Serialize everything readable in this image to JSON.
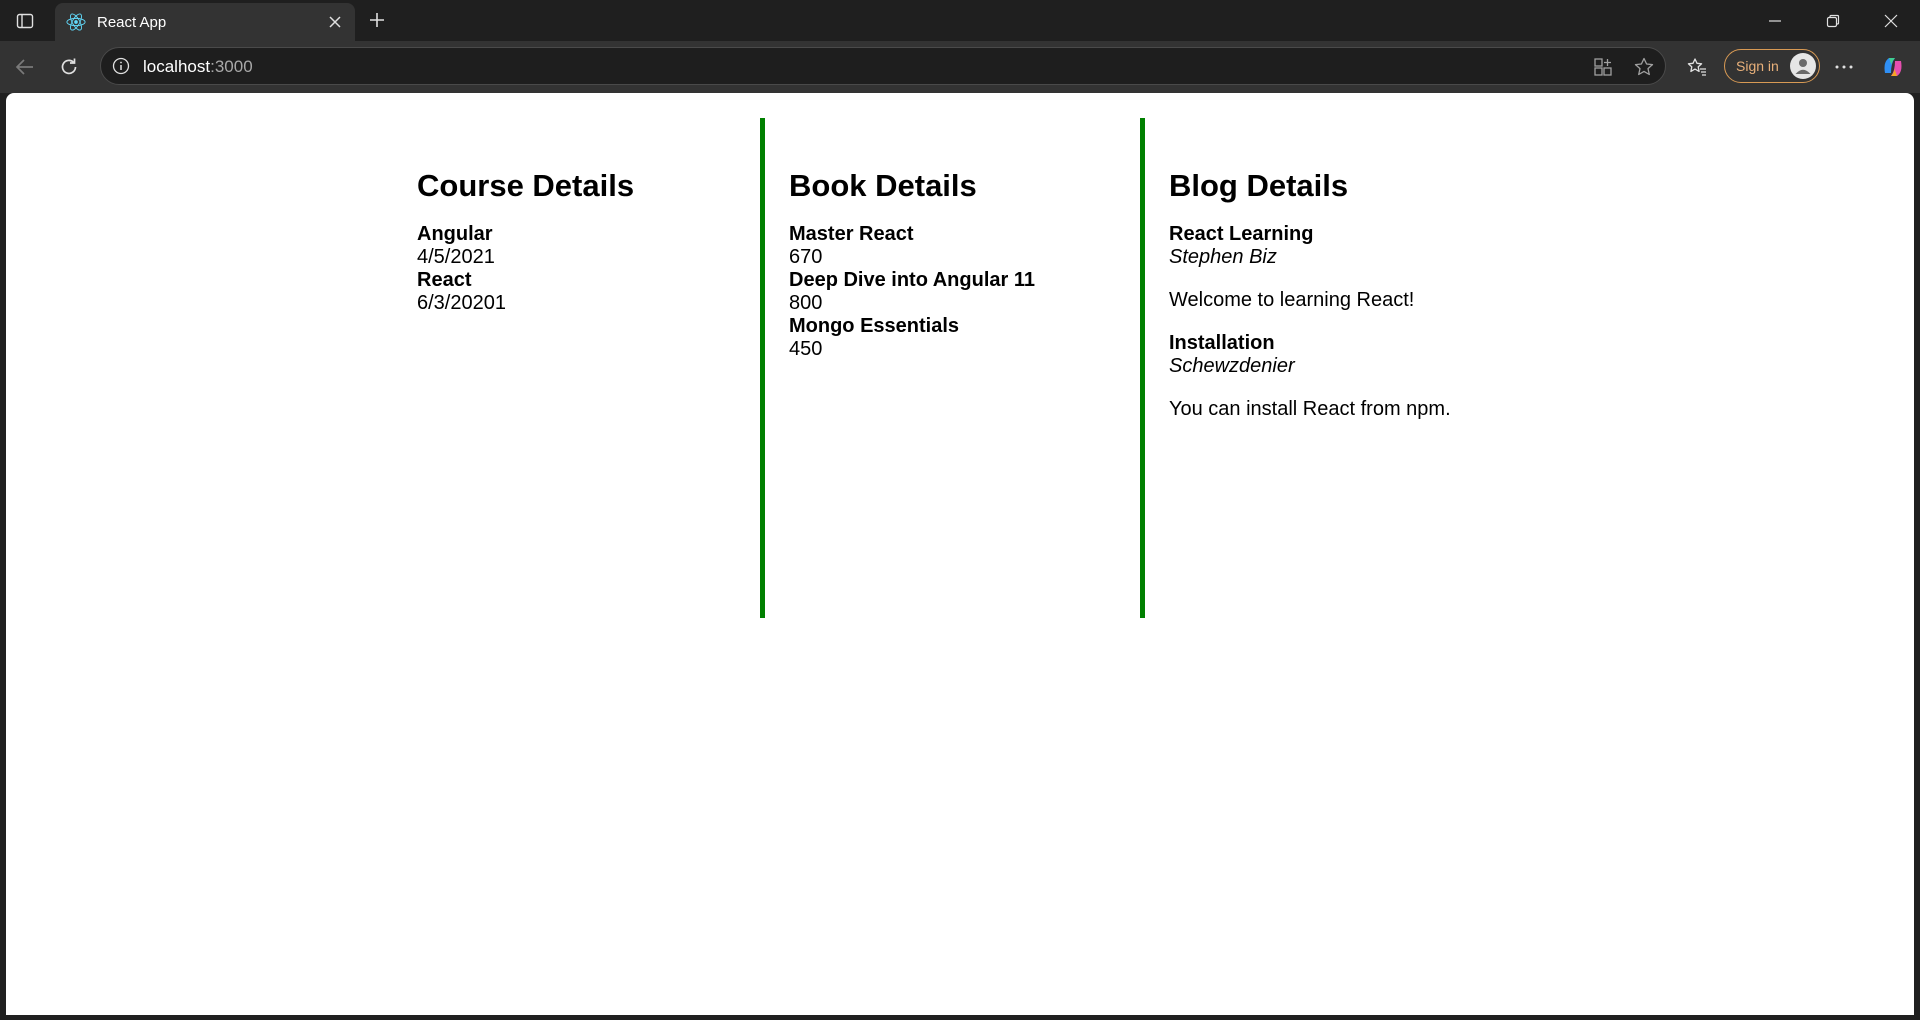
{
  "browser": {
    "tab_title": "React App",
    "url_host": "localhost",
    "url_port": ":3000",
    "sign_in_label": "Sign in"
  },
  "page": {
    "courses": {
      "heading": "Course Details",
      "items": [
        {
          "name": "Angular",
          "date": "4/5/2021"
        },
        {
          "name": "React",
          "date": "6/3/20201"
        }
      ]
    },
    "books": {
      "heading": "Book Details",
      "items": [
        {
          "name": "Master React",
          "price": "670"
        },
        {
          "name": "Deep Dive into Angular 11",
          "price": "800"
        },
        {
          "name": "Mongo Essentials",
          "price": "450"
        }
      ]
    },
    "blogs": {
      "heading": "Blog Details",
      "items": [
        {
          "title": "React Learning",
          "author": "Stephen Biz",
          "content": "Welcome to learning React!"
        },
        {
          "title": "Installation",
          "author": "Schewzdenier",
          "content": "You can install React from npm."
        }
      ]
    }
  },
  "colors": {
    "divider": "#008000",
    "sign_in_accent": "#d89a54"
  }
}
